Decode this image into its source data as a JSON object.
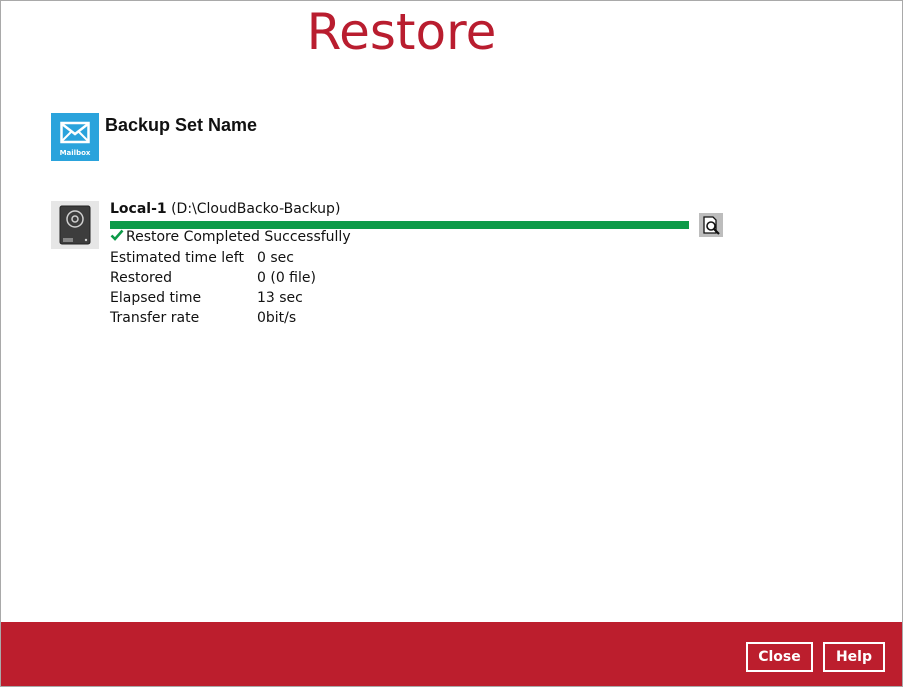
{
  "header": {
    "title": "Restore"
  },
  "backup_set": {
    "icon": "mailbox-icon",
    "icon_caption": "Mailbox",
    "name": "Backup Set Name"
  },
  "destination": {
    "icon": "hard-drive-icon",
    "name": "Local-1",
    "path": "(D:\\CloudBacko-Backup)",
    "progress_percent": 100,
    "progress_color": "#0c9a48",
    "log_button_icon": "view-log-icon",
    "status_icon": "checkmark-icon",
    "status_text": "Restore Completed Successfully",
    "stats": [
      {
        "label": "Estimated time left",
        "value": "0 sec"
      },
      {
        "label": "Restored",
        "value": "0 (0 file)"
      },
      {
        "label": "Elapsed time",
        "value": "13 sec"
      },
      {
        "label": "Transfer rate",
        "value": "0bit/s"
      }
    ]
  },
  "footer": {
    "close_label": "Close",
    "help_label": "Help"
  },
  "colors": {
    "accent": "#bc1e2d",
    "title": "#b91d2f",
    "mailbox_icon_bg": "#2aa3dc",
    "success": "#0c9a48"
  }
}
